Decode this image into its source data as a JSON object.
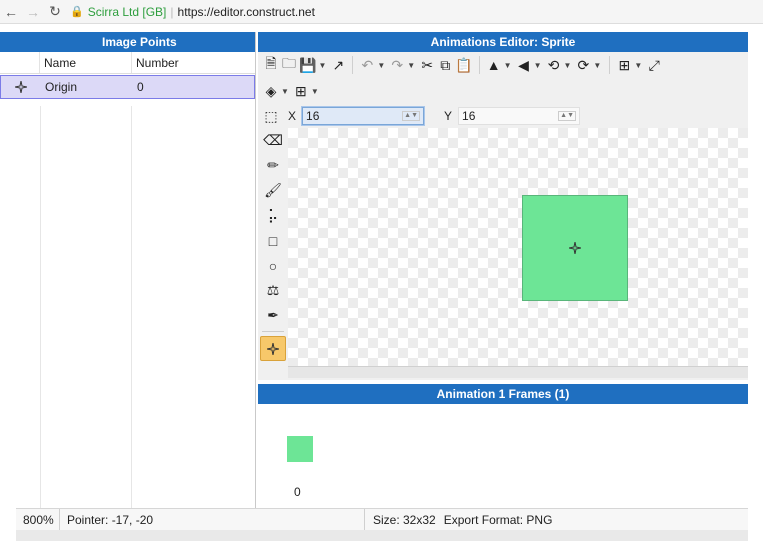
{
  "browser": {
    "back_icon": "back-arrow-icon",
    "forward_icon": "forward-arrow-icon",
    "reload_icon": "reload-icon",
    "cert_label": "Scirra Ltd [GB]",
    "url": "https://editor.construct.net"
  },
  "image_points": {
    "title": "Image Points",
    "columns": [
      "Name",
      "Number"
    ],
    "rows": [
      {
        "icon": "origin-point-icon",
        "name": "Origin",
        "number": "0"
      }
    ]
  },
  "editor": {
    "title": "Animations Editor: Sprite",
    "toolbar_icons": [
      "new-icon",
      "open-icon",
      "save-icon",
      "export-icon",
      "undo-icon",
      "redo-icon",
      "cut-icon",
      "copy-icon",
      "paste-icon",
      "flip-horizontal-icon",
      "flip-vertical-icon",
      "rotate-ccw-icon",
      "rotate-cw-icon",
      "crop-icon",
      "resize-icon",
      "layers-icon",
      "grid-icon"
    ],
    "x_label": "X",
    "x_value": "16",
    "y_label": "Y",
    "y_value": "16",
    "tools": [
      "select-rect-icon",
      "eraser-icon",
      "pencil-icon",
      "brush-icon",
      "line-icon",
      "rectangle-icon",
      "ellipse-icon",
      "fill-bucket-icon",
      "eyedropper-icon",
      "image-point-icon"
    ],
    "active_tool": "image-point-icon",
    "sprite_color": "#6de596"
  },
  "frames": {
    "title": "Animation 1 Frames (1)",
    "items": [
      {
        "index": "0"
      }
    ]
  },
  "status": {
    "zoom": "800%",
    "pointer": "Pointer: -17, -20",
    "size": "Size: 32x32",
    "format": "Export Format: PNG"
  },
  "colors": {
    "header_blue": "#1f6fc0",
    "selected_row": "#dcd9f7",
    "sprite_green": "#6de596",
    "active_tool": "#f7c86a"
  }
}
